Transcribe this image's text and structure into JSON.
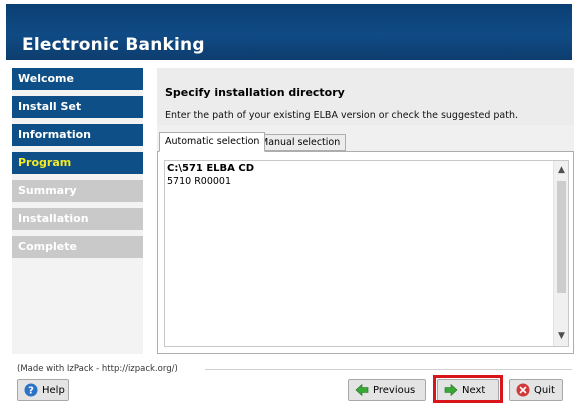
{
  "header": {
    "title": "Electronic Banking"
  },
  "sidebar": {
    "items": [
      {
        "label": "Welcome",
        "state": "done"
      },
      {
        "label": "Install Set",
        "state": "done"
      },
      {
        "label": "Information",
        "state": "done"
      },
      {
        "label": "Program",
        "state": "active"
      },
      {
        "label": "Summary",
        "state": "pending"
      },
      {
        "label": "Installation",
        "state": "pending"
      },
      {
        "label": "Complete",
        "state": "pending"
      }
    ]
  },
  "panel": {
    "title": "Specify installation directory",
    "description": "Enter the path of your existing ELBA version or check the suggested path.",
    "tabs": [
      {
        "label": "Automatic selection",
        "active": true
      },
      {
        "label": "Manual selection",
        "active": false
      }
    ],
    "list": {
      "items": [
        {
          "text": "C:\\571 ELBA CD",
          "bold": true
        },
        {
          "text": "5710 R00001",
          "bold": false
        }
      ]
    }
  },
  "footer": {
    "made_with": "(Made with IzPack - http://izpack.org/)",
    "buttons": {
      "help": "Help",
      "previous": "Previous",
      "next": "Next",
      "quit": "Quit"
    }
  },
  "colors": {
    "header_bg": "#0d4478",
    "nav_done": "#0d4f86",
    "nav_active_text": "#f2ea26",
    "nav_pending": "#c9c9c9",
    "next_highlight": "#d9141b"
  }
}
